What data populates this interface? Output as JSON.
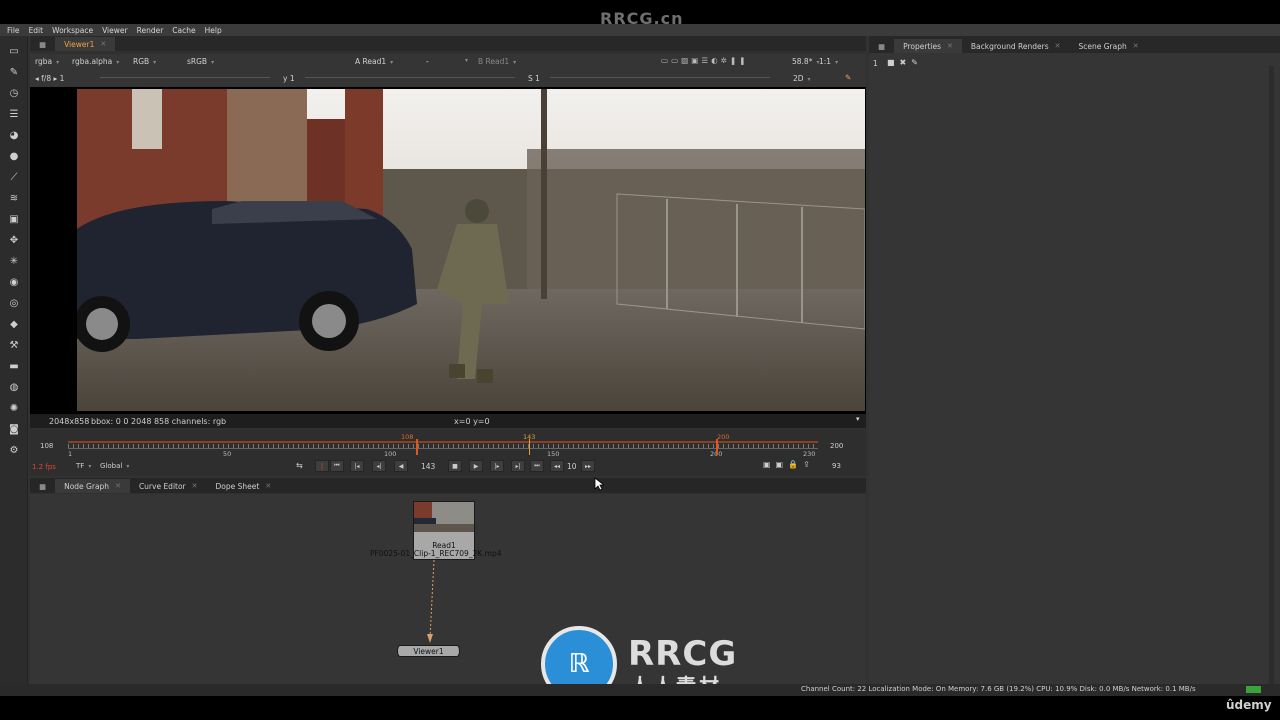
{
  "brand_top": "RRCG.cn",
  "menu": [
    "File",
    "Edit",
    "Workspace",
    "Viewer",
    "Render",
    "Cache",
    "Help"
  ],
  "viewer_tab": {
    "label": "Viewer1"
  },
  "viewer_controls": {
    "channels": "rgba",
    "alpha": "rgba.alpha",
    "color": "RGB",
    "lut": "sRGB",
    "input_a": "A",
    "input_a_value": "Read1",
    "wipe": "-",
    "input_b": "B",
    "input_b_value": "Read1",
    "zoom": "58.8*",
    "proxy": "1:1",
    "fstop": "f/8",
    "fstop_value": "1",
    "y_label": "y",
    "y_value": "1",
    "s_label": "S",
    "s_value": "1",
    "view_mode": "2D"
  },
  "info": {
    "format": "2048x858",
    "bbox": "bbox: 0 0 2048 858 channels: rgb",
    "coords": "x=0 y=0"
  },
  "timeline": {
    "start": "108",
    "end": "200",
    "ticks": [
      "1",
      "50",
      "100",
      "150",
      "200",
      "230"
    ],
    "in_marker": "108",
    "current_marker": "143",
    "out_marker": "200",
    "fps": "1.2 fps",
    "tf": "TF",
    "scope": "Global",
    "current_frame": "143",
    "step": "10",
    "end_frame_display": "93",
    "progress_fraction": 0.57
  },
  "bottom_tabs": [
    "Node Graph",
    "Curve Editor",
    "Dope Sheet"
  ],
  "nodes": {
    "read": {
      "name": "Read1",
      "file": "PF0025-01_Clip-1_REC709_2K.mp4"
    },
    "viewer": {
      "name": "Viewer1"
    }
  },
  "right_tabs": [
    "Properties",
    "Background Renders",
    "Scene Graph"
  ],
  "properties_count": "1",
  "status": "Channel Count: 22  Localization Mode: On  Memory: 7.6 GB (19.2%)  CPU: 10.9%  Disk: 0.0 MB/s  Network: 0.1 MB/s",
  "logo": {
    "title": "RRCG",
    "subtitle": "人人素材"
  },
  "udemy": "ûdemy",
  "colors": {
    "accent": "#f0a244",
    "marker": "#d65a22",
    "panel": "#323232"
  }
}
